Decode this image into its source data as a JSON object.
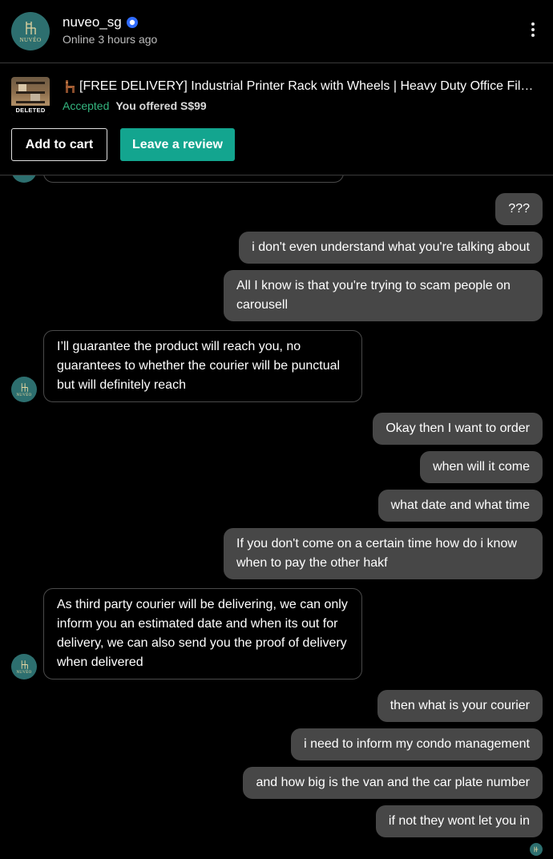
{
  "header": {
    "seller_name": "nuveo_sg",
    "status": "Online 3 hours ago",
    "avatar_brand": "NUVÉO",
    "verified_icon": "verified-badge-icon",
    "menu_icon": "more-vertical-icon"
  },
  "listing": {
    "thumbnail_label": "DELETED",
    "title": "[FREE DELIVERY] Industrial Printer Rack with Wheels | Heavy Duty Office File ...",
    "status": "Accepted",
    "offer": "You offered S$99",
    "add_to_cart_label": "Add to cart",
    "leave_review_label": "Leave a review",
    "accent_color": "#13a58f",
    "accepted_color": "#34b57f"
  },
  "messages": [
    {
      "from": "me",
      "text": "???"
    },
    {
      "from": "me",
      "text": "i don't even understand what you're talking about"
    },
    {
      "from": "me",
      "text": "All I know is that you're trying to scam people on carousell"
    },
    {
      "from": "seller",
      "text": "I’ll guarantee the product will reach you, no guarantees to whether the courier will be punctual but will definitely reach"
    },
    {
      "from": "me",
      "text": "Okay then I want to order"
    },
    {
      "from": "me",
      "text": "when will it come"
    },
    {
      "from": "me",
      "text": "what date and what time"
    },
    {
      "from": "me",
      "text": "If you don't come on a certain time how do i know when to pay the other hakf"
    },
    {
      "from": "seller",
      "text": "As third party courier will be delivering, we can only inform you an estimated date and when its out for delivery, we can also send you the proof of delivery when delivered"
    },
    {
      "from": "me",
      "text": "then what is your courier"
    },
    {
      "from": "me",
      "text": "i need to inform my condo management"
    },
    {
      "from": "me",
      "text": "and how big is the van and the car plate number"
    },
    {
      "from": "me",
      "text": "if not they wont let you in"
    }
  ],
  "colors": {
    "background": "#000000",
    "sent_bubble": "#474747",
    "received_border": "#4a4a4a",
    "avatar_bg": "#2d6f6f"
  }
}
